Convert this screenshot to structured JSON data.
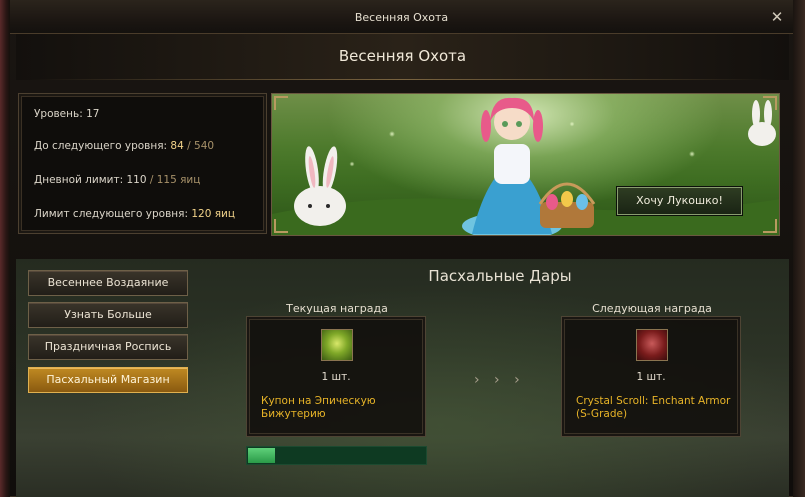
{
  "window": {
    "title": "Весенняя Охота",
    "close_icon": "close-icon"
  },
  "header": {
    "title": "Весенняя Охота"
  },
  "stats": {
    "level_label": "Уровень:",
    "level_value": "17",
    "next_label": "До следующего уровня:",
    "next_current": "84",
    "next_sep": "/",
    "next_max": "540",
    "daily_label": "Дневной лимит:",
    "daily_current": "110",
    "daily_max": "115 яиц",
    "next_limit_label": "Лимит следующего уровня:",
    "next_limit_value": "120 яиц"
  },
  "banner": {
    "cta_label": "Хочу Лукошко!"
  },
  "side_menu": {
    "items": [
      {
        "label": "Весеннее Воздаяние",
        "active": false
      },
      {
        "label": "Узнать Больше",
        "active": false
      },
      {
        "label": "Праздничная Роспись",
        "active": false
      },
      {
        "label": "Пасхальный Магазин",
        "active": true
      }
    ]
  },
  "gifts": {
    "title": "Пасхальные Дары",
    "current": {
      "caption": "Текущая награда",
      "icon": "green-coupon-icon",
      "qty": "1 шт.",
      "name": "Купон на Эпическую Бижутерию"
    },
    "next": {
      "caption": "Следующая награда",
      "icon": "red-scroll-icon",
      "qty": "1 шт.",
      "name": "Crystal Scroll: Enchant Armor (S-Grade)"
    },
    "arrows_icon": "chevron-right-icon",
    "arrows_text": "› › ›",
    "progress": 0.15
  },
  "colors": {
    "accent_gold": "#e8b428",
    "active_button": "#c08a22",
    "progress_green": "#2a9a48"
  }
}
